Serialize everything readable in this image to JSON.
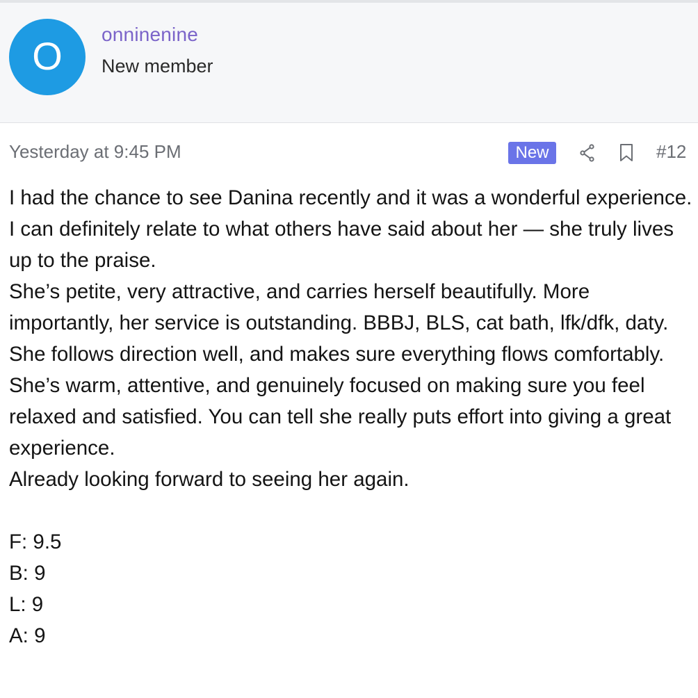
{
  "author": {
    "avatar_letter": "O",
    "avatar_color": "#1e9be3",
    "username": "onninenine",
    "username_color": "#7b64c9",
    "title": "New member"
  },
  "post": {
    "timestamp": "Yesterday at 9:45 PM",
    "badge": "New",
    "badge_color": "#6a74e8",
    "share_icon": "share-icon",
    "bookmark_icon": "bookmark-icon",
    "number": "#12",
    "paragraphs": [
      "I had the chance to see Danina recently and it was a wonderful experience. I can definitely relate to what others have said about her — she truly lives up to the praise.",
      "She’s petite, very attractive, and carries herself beautifully. More importantly, her service is outstanding. BBBJ, BLS, cat bath, lfk/dfk, daty.",
      "She follows direction well, and makes sure everything flows comfortably.",
      "She’s warm, attentive, and genuinely focused on making sure you feel relaxed and satisfied. You can tell she really puts effort into giving a great experience.",
      "Already looking forward to seeing her again."
    ],
    "ratings": [
      "F: 9.5",
      "B: 9",
      "L: 9",
      "A: 9"
    ]
  }
}
